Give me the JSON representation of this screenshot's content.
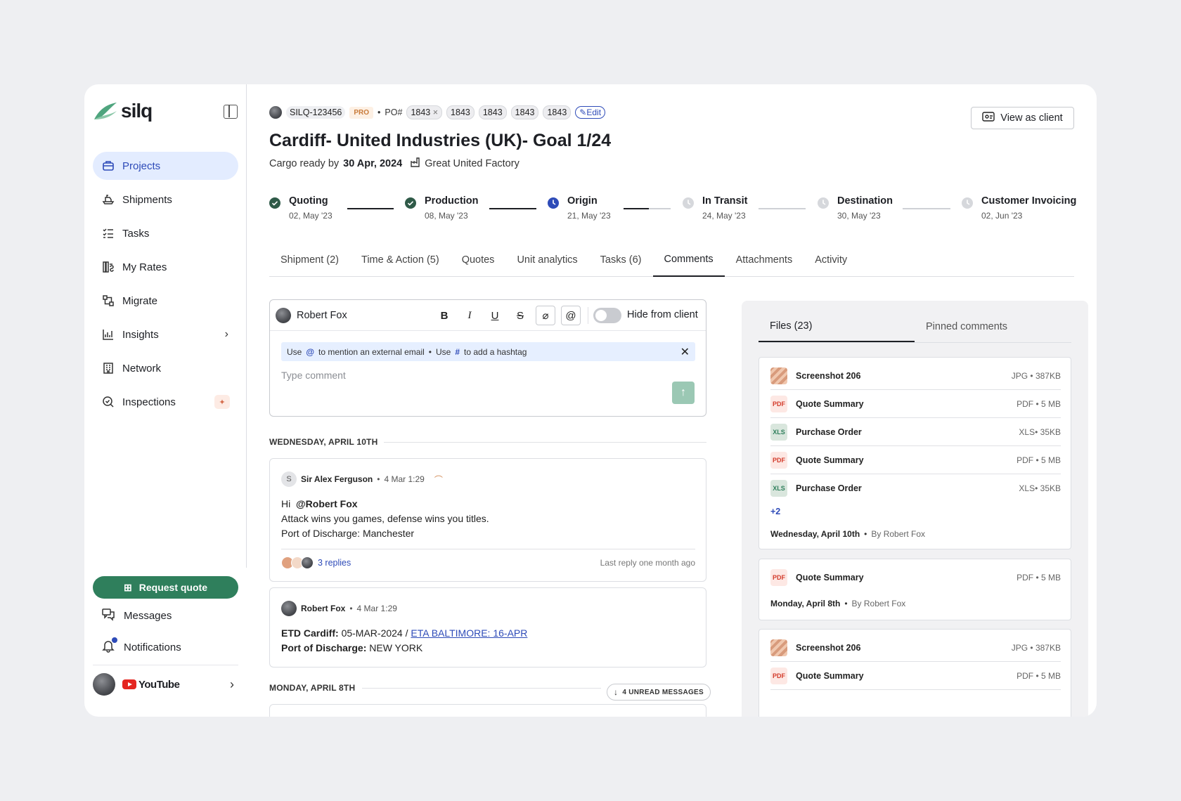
{
  "sidebar": {
    "logo": "silq",
    "nav": [
      {
        "label": "Projects",
        "icon": "briefcase-icon",
        "active": true
      },
      {
        "label": "Shipments",
        "icon": "ship-icon"
      },
      {
        "label": "Tasks",
        "icon": "task-list-icon"
      },
      {
        "label": "My Rates",
        "icon": "rates-icon"
      },
      {
        "label": "Migrate",
        "icon": "migrate-icon"
      },
      {
        "label": "Insights",
        "icon": "chart-icon"
      },
      {
        "label": "Network",
        "icon": "building-icon"
      },
      {
        "label": "Inspections",
        "icon": "search-check-icon"
      }
    ],
    "request_quote": "Request quote",
    "messages": "Messages",
    "notifications": "Notifications",
    "workspace": "YouTube"
  },
  "header": {
    "project_id": "SILQ-123456",
    "badge": "PRO",
    "po_label": "PO#",
    "po_numbers": [
      "1843",
      "1843",
      "1843",
      "1843",
      "1843"
    ],
    "edit_label": "Edit",
    "title": "Cardiff- United Industries (UK)- Goal 1/24",
    "cargo_label": "Cargo ready by",
    "cargo_date": "30 Apr, 2024",
    "factory": "Great United Factory",
    "view_as_client": "View as client"
  },
  "timeline": [
    {
      "name": "Quoting",
      "date": "02, May '23",
      "status": "done"
    },
    {
      "name": "Production",
      "date": "08, May '23",
      "status": "done"
    },
    {
      "name": "Origin",
      "date": "21, May '23",
      "status": "current"
    },
    {
      "name": "In Transit",
      "date": "24, May '23",
      "status": "pending"
    },
    {
      "name": "Destination",
      "date": "30, May '23",
      "status": "pending"
    },
    {
      "name": "Customer Invoicing",
      "date": "02, Jun '23",
      "status": "pending"
    }
  ],
  "tabs": [
    "Shipment (2)",
    "Time & Action (5)",
    "Quotes",
    "Unit analytics",
    "Tasks (6)",
    "Comments",
    "Attachments",
    "Activity"
  ],
  "active_tab": "Comments",
  "composer": {
    "user": "Robert Fox",
    "hide_label": "Hide from client",
    "hint_use1": "Use",
    "hint_at": "@",
    "hint_mention": "to mention an external email",
    "hint_sep": "•",
    "hint_use2": "Use",
    "hint_hash": "#",
    "hint_hashtag": "to add a hashtag",
    "placeholder": "Type comment"
  },
  "feed": {
    "day1": "WEDNESDAY, APRIL 10TH",
    "comment1": {
      "initial": "S",
      "author": "Sir Alex Ferguson",
      "time": "4 Mar 1:29",
      "greeting": "Hi",
      "mention": "@Robert Fox",
      "line2": "Attack wins you games, defense wins you titles.",
      "line3": "Port of Discharge: Manchester",
      "replies": "3 replies",
      "last_reply": "Last reply one month ago"
    },
    "comment2": {
      "author": "Robert Fox",
      "time": "4 Mar 1:29",
      "etd_label": "ETD Cardiff:",
      "etd_value": "05-MAR-2024 /",
      "eta_link": "ETA BALTIMORE: 16-APR",
      "port_label": "Port of Discharge:",
      "port_value": "NEW YORK"
    },
    "day2": "MONDAY, APRIL 8TH",
    "unread": "4 UNREAD MESSAGES"
  },
  "files_panel": {
    "tab_files": "Files (23)",
    "tab_pinned": "Pinned comments",
    "group1": {
      "files": [
        {
          "name": "Screenshot 206",
          "meta": "JPG • 387KB",
          "type": "img"
        },
        {
          "name": "Quote Summary",
          "meta": "PDF • 5 MB",
          "type": "pdf"
        },
        {
          "name": "Purchase Order",
          "meta": "XLS• 35KB",
          "type": "xls"
        },
        {
          "name": "Quote Summary",
          "meta": "PDF • 5 MB",
          "type": "pdf"
        },
        {
          "name": "Purchase Order",
          "meta": "XLS• 35KB",
          "type": "xls"
        }
      ],
      "more": "+2",
      "date": "Wednesday, April 10th",
      "by": "By Robert Fox"
    },
    "group2": {
      "files": [
        {
          "name": "Quote Summary",
          "meta": "PDF • 5 MB",
          "type": "pdf"
        }
      ],
      "date": "Monday, April 8th",
      "by": "By Robert Fox"
    },
    "group3": {
      "files": [
        {
          "name": "Screenshot 206",
          "meta": "JPG • 387KB",
          "type": "img"
        },
        {
          "name": "Quote Summary",
          "meta": "PDF • 5 MB",
          "type": "pdf"
        }
      ]
    }
  },
  "colors": {
    "accent": "#2e4bb8",
    "brand_green": "#2f7f5c",
    "background": "#eeeff2"
  }
}
